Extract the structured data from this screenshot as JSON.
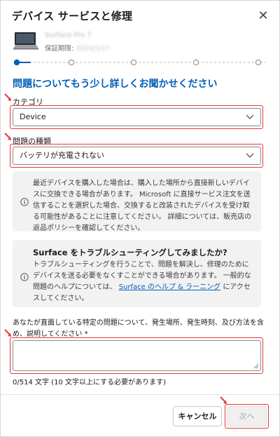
{
  "dialog": {
    "title": "デバイス サービスと修理",
    "close_icon": "close-icon"
  },
  "device": {
    "name": "Surface Pro 7",
    "warranty_label": "保証期限:",
    "warranty_date": "2024/3/17"
  },
  "progress": {
    "steps": 6,
    "current_step": 1
  },
  "heading": "問題についてもう少し詳しくお聞かせください",
  "category": {
    "label": "カテゴリ",
    "value": "Device"
  },
  "issue_type": {
    "label": "問題の種類",
    "value": "バッテリが充電されない"
  },
  "notice": {
    "text": "最近デバイスを購入した場合は、購入した場所から直接新しいデバイスに交換できる場合があります。 Microsoft に直接サービス注文を送信することを選択した場合、交換すると改装されたデバイスを受け取る可能性があることに注意してください。 詳細については、販売店の返品ポリシーを確認してください。"
  },
  "tip": {
    "title": "Surface をトラブルシューティングしてみましたか?",
    "text_before": "トラブルシューティングを行うことで、問題を解決し、修理のためにデバイスを送る必要をなくすことができる場合があります。 一般的な問題のヘルプについては、",
    "link": "Surface のヘルプ & ラーニング",
    "text_after": "にアクセスしてください。"
  },
  "description": {
    "label": "あなたが直面している特定の問題について、発生場所、発生時刻、及び方法を含め、説明してください *",
    "value": "",
    "counter": "0/514 文字 (10 文字以上にする必要があります)"
  },
  "footer": {
    "cancel_label": "キャンセル",
    "next_label": "次へ"
  },
  "colors": {
    "accent": "#005fb8",
    "highlight": "#e53935",
    "info_bg": "#f2f2f2"
  }
}
